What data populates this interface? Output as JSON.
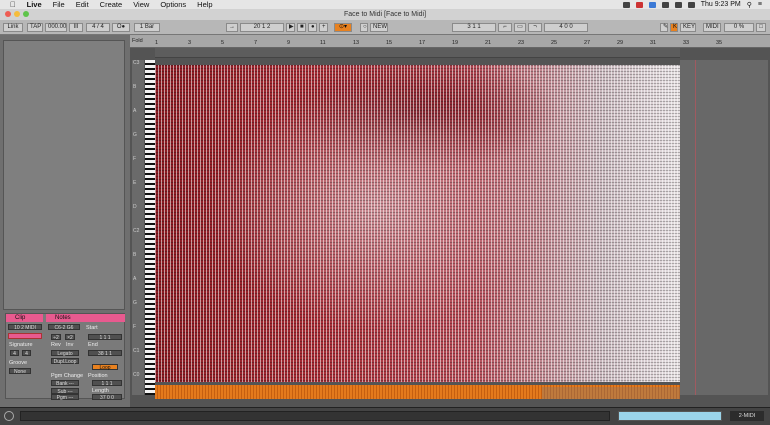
{
  "menubar": {
    "app": "Live",
    "items": [
      "File",
      "Edit",
      "Create",
      "View",
      "Options",
      "Help"
    ],
    "clock": "Thu 9:23 PM"
  },
  "window": {
    "title": "Face to Midi  [Face to Midi]"
  },
  "transport": {
    "link": "Link",
    "tap": "TAP",
    "tempo": "000.00",
    "metro": "III",
    "sig": "4 / 4",
    "bar_quant": "1 Bar",
    "position": "20   1   2",
    "loop_start": "3   1   1",
    "loop_len": "4   0   0",
    "new": "NEW",
    "key": "KEY",
    "midi": "MIDI",
    "cpu": "0 %"
  },
  "ruler": {
    "label": "Fold",
    "marks": [
      "1",
      "3",
      "5",
      "7",
      "9",
      "11",
      "13",
      "15",
      "17",
      "19",
      "21",
      "23",
      "25",
      "27",
      "29",
      "31",
      "33",
      "35"
    ]
  },
  "key_labels": [
    "C3",
    "B",
    "A",
    "G",
    "F",
    "E",
    "D",
    "C2",
    "B",
    "A",
    "G",
    "F",
    "C1",
    "C0"
  ],
  "clip": {
    "header": "Clip",
    "name": "10 2 MIDI",
    "signature_label": "Signature",
    "sig_num": "4",
    "sig_den": "4",
    "groove_label": "Groove",
    "groove_value": "None"
  },
  "notes": {
    "header": "Notes",
    "pitch": "C6-2 G6",
    "rev": "Rev",
    "inv": "Inv",
    "start_label": "Start",
    "end_label": "End",
    "start_val": "1   1   1",
    "end_val": "38   1   1",
    "legato": "Legato",
    "dupl": "Dupl.Loop",
    "pgm": "Pgm Change",
    "bank": "Bank ---",
    "sub": "Sub ---",
    "pgm2": "Pgm ---",
    "position_label": "Position",
    "length_label": "Length",
    "loop_btn": "Loop",
    "pos_val": "1   1   1",
    "len_val": "37   0   0",
    "x1": "÷2",
    "x2": "×2"
  },
  "status": {
    "track": "2-MIDI"
  }
}
